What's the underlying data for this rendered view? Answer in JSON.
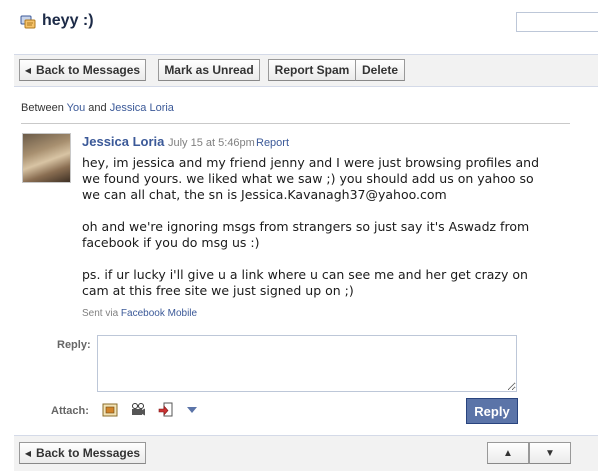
{
  "header": {
    "title": "heyy :)",
    "icon": "message-icon"
  },
  "toolbar": {
    "back": "Back to Messages",
    "mark_unread": "Mark as Unread",
    "report_spam": "Report Spam",
    "delete": "Delete"
  },
  "between": {
    "prefix": "Between",
    "you": "You",
    "and": "and",
    "other": "Jessica Loria"
  },
  "message": {
    "sender": "Jessica Loria",
    "timestamp": "July 15 at 5:46pm",
    "report": "Report",
    "paragraphs": [
      "hey, im jessica and my friend jenny and I were just browsing profiles and we found yours. we liked what we saw ;) you should add us on yahoo so we can all chat, the sn is Jessica.Kavanagh37@yahoo.com",
      "oh and we're ignoring msgs from strangers so just say it's Aswadz from facebook if you do msg us :)",
      "ps. if ur lucky i'll give u a link where u can see me and her get crazy on cam at this free site we just signed up on ;)"
    ],
    "sent_via_prefix": "Sent via",
    "sent_via_link": "Facebook Mobile"
  },
  "reply": {
    "label": "Reply:",
    "attach_label": "Attach:",
    "button": "Reply"
  },
  "bottom": {
    "back": "Back to Messages",
    "up": "▲",
    "down": "▼"
  },
  "colors": {
    "link": "#3b5998",
    "reply_button": "#5b74a8"
  }
}
